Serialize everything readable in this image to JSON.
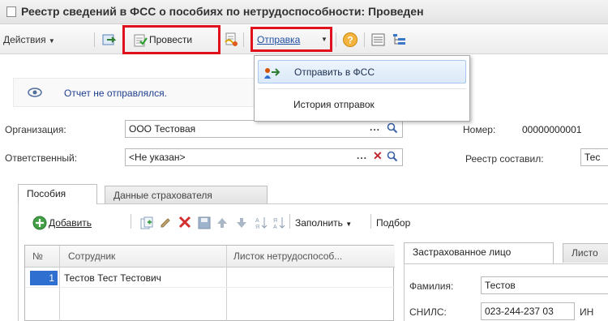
{
  "window": {
    "title": "Реестр сведений в ФСС о пособиях по нетрудоспособности: Проведен"
  },
  "toolbar": {
    "actions_label": "Действия",
    "post_label": "Провести",
    "send_label": "Отправка"
  },
  "send_menu": {
    "items": [
      {
        "label": "Отправить в ФСС"
      },
      {
        "label": "История отправок"
      }
    ]
  },
  "info": {
    "status_text": "Отчет не отправлялся."
  },
  "form": {
    "org_label": "Организация:",
    "org_value": "ООО Тестовая",
    "responsible_label": "Ответственный:",
    "responsible_value": "<Не указан>",
    "number_label": "Номер:",
    "number_value": "00000000001",
    "compiled_by_label": "Реестр составил:",
    "compiled_by_value": "Тес"
  },
  "tabs": [
    {
      "label": "Пособия"
    },
    {
      "label": "Данные страхователя"
    }
  ],
  "grid_toolbar": {
    "add_label": "Добавить",
    "fill_label": "Заполнить",
    "select_label": "Подбор"
  },
  "grid": {
    "columns": [
      "№",
      "Сотрудник",
      "Листок нетрудоспособ..."
    ],
    "rows": [
      {
        "num": "1",
        "employee": "Тестов Тест Тестович",
        "sheet": ""
      }
    ]
  },
  "detail": {
    "tabs": [
      "Застрахованное лицо",
      "Листо"
    ],
    "lastname_label": "Фамилия:",
    "lastname_value": "Тестов",
    "snils_label": "СНИЛС:",
    "snils_value": "023-244-237 03",
    "inn_label": "ИН"
  },
  "colors": {
    "highlight_red": "#e0101c",
    "selection_blue": "#2f6fcf",
    "menu_hover": "#dbe9f9"
  }
}
